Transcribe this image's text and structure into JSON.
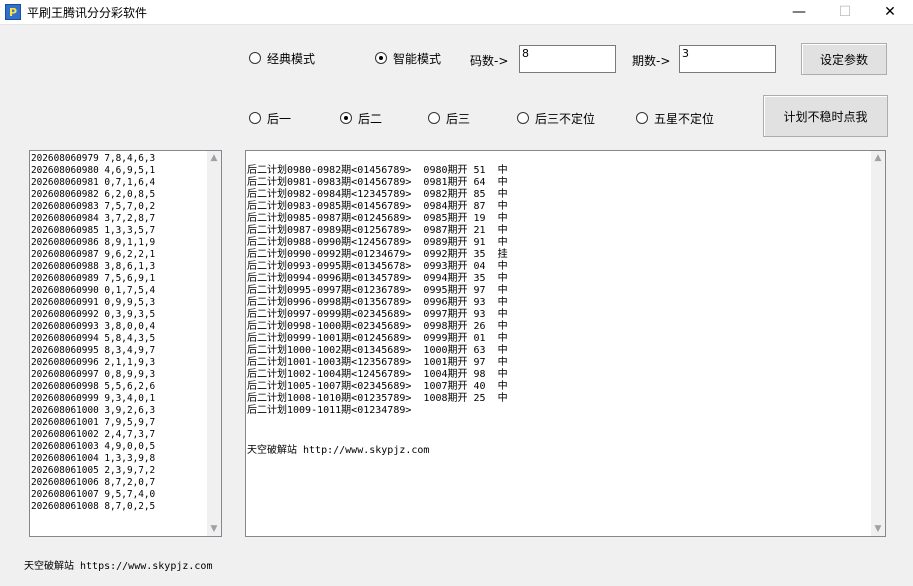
{
  "window": {
    "title": "平刷王腾讯分分彩软件",
    "min_glyph": "—",
    "max_glyph": "☐",
    "close_glyph": "✕"
  },
  "mode": {
    "classic_label": "经典模式",
    "smart_label": "智能模式",
    "selected": "smart"
  },
  "params": {
    "code_count_label": "码数->",
    "code_count_value": "8",
    "period_count_label": "期数->",
    "period_count_value": "3",
    "set_button": "设定参数",
    "unstable_button": "计划不稳时点我"
  },
  "position": {
    "options": [
      "后一",
      "后二",
      "后三",
      "后三不定位",
      "五星不定位"
    ],
    "selected": 1
  },
  "history": [
    "202608060979 7,8,4,6,3",
    "202608060980 4,6,9,5,1",
    "202608060981 0,7,1,6,4",
    "202608060982 6,2,0,8,5",
    "202608060983 7,5,7,0,2",
    "202608060984 3,7,2,8,7",
    "202608060985 1,3,3,5,7",
    "202608060986 8,9,1,1,9",
    "202608060987 9,6,2,2,1",
    "202608060988 3,8,6,1,3",
    "202608060989 7,5,6,9,1",
    "202608060990 0,1,7,5,4",
    "202608060991 0,9,9,5,3",
    "202608060992 0,3,9,3,5",
    "202608060993 3,8,0,0,4",
    "202608060994 5,8,4,3,5",
    "202608060995 8,3,4,9,7",
    "202608060996 2,1,1,9,3",
    "202608060997 0,8,9,9,3",
    "202608060998 5,5,6,2,6",
    "202608060999 9,3,4,0,1",
    "202608061000 3,9,2,6,3",
    "202608061001 7,9,5,9,7",
    "202608061002 2,4,7,3,7",
    "202608061003 4,9,0,0,5",
    "202608061004 1,3,3,9,8",
    "202608061005 2,3,9,7,2",
    "202608061006 8,7,2,0,7",
    "202608061007 9,5,7,4,0",
    "202608061008 8,7,0,2,5"
  ],
  "plan": [
    "后二计划0980-0982期<01456789>  0980期开 51  中",
    "后二计划0981-0983期<01456789>  0981期开 64  中",
    "后二计划0982-0984期<12345789>  0982期开 85  中",
    "后二计划0983-0985期<01456789>  0984期开 87  中",
    "后二计划0985-0987期<01245689>  0985期开 19  中",
    "后二计划0987-0989期<01256789>  0987期开 21  中",
    "后二计划0988-0990期<12456789>  0989期开 91  中",
    "后二计划0990-0992期<01234679>  0992期开 35  挂",
    "后二计划0993-0995期<01345678>  0993期开 04  中",
    "后二计划0994-0996期<01345789>  0994期开 35  中",
    "后二计划0995-0997期<01236789>  0995期开 97  中",
    "后二计划0996-0998期<01356789>  0996期开 93  中",
    "后二计划0997-0999期<02345689>  0997期开 93  中",
    "后二计划0998-1000期<02345689>  0998期开 26  中",
    "后二计划0999-1001期<01245689>  0999期开 01  中",
    "后二计划1000-1002期<01345689>  1000期开 63  中",
    "后二计划1001-1003期<12356789>  1001期开 97  中",
    "后二计划1002-1004期<12456789>  1004期开 98  中",
    "后二计划1005-1007期<02345689>  1007期开 40  中",
    "后二计划1008-1010期<01235789>  1008期开 25  中",
    "后二计划1009-1011期<01234789>"
  ],
  "plan_footer": "天空破解站 http://www.skypjz.com",
  "status_text": "天空破解站 https://www.skypjz.com"
}
